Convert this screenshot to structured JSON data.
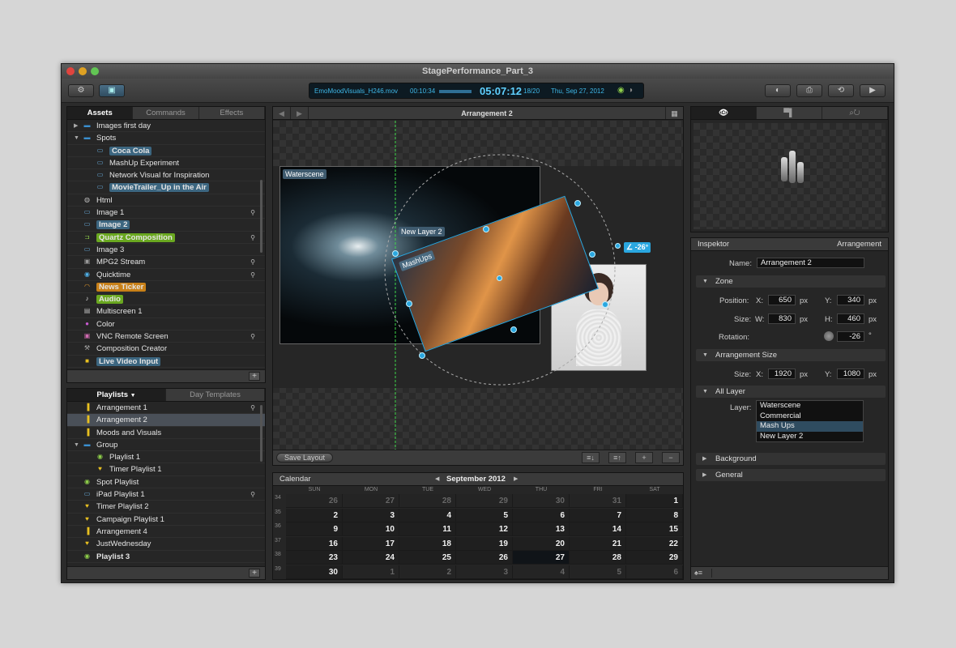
{
  "window": {
    "title": "StagePerformance_Part_3"
  },
  "toolbar": {
    "left_buttons": [
      {
        "icon": "gear-icon",
        "glyph": "⚙"
      },
      {
        "icon": "calendar-icon",
        "glyph": "▣"
      }
    ],
    "right_buttons": [
      {
        "icon": "record-icon",
        "glyph": "◐"
      },
      {
        "icon": "printer-icon",
        "glyph": "⎙"
      },
      {
        "icon": "sync-icon",
        "glyph": "⟲"
      },
      {
        "icon": "play-icon",
        "glyph": "▶"
      }
    ],
    "lcd": {
      "file": "EmoMoodVisuals_H246.mov",
      "elapsed": "00:10:34",
      "time": "05:07:12",
      "count": "18/20",
      "date": "Thu, Sep 27, 2012"
    }
  },
  "assets": {
    "tabs": [
      "Assets",
      "Commands",
      "Effects"
    ],
    "items": [
      {
        "label": "Images first day",
        "icon": "▬",
        "color": "#3a8fd0",
        "level": 0,
        "twisty": "▶"
      },
      {
        "label": "Spots",
        "icon": "▬",
        "color": "#3a8fd0",
        "level": 0,
        "twisty": "▼"
      },
      {
        "label": "Coca Cola",
        "icon": "▭",
        "color": "#6ab0e0",
        "level": 1,
        "tag": "#3c6680"
      },
      {
        "label": "MashUp Experiment",
        "icon": "▭",
        "color": "#6ab0e0",
        "level": 1
      },
      {
        "label": "Network Visual for Inspiration",
        "icon": "▭",
        "color": "#6ab0e0",
        "level": 1
      },
      {
        "label": "MovieTrailer_Up in the Air",
        "icon": "▭",
        "color": "#6ab0e0",
        "level": 1,
        "tag": "#3c6680"
      },
      {
        "label": "Html",
        "icon": "◍",
        "color": "#bbb",
        "level": 0
      },
      {
        "label": "Image 1",
        "icon": "▭",
        "color": "#6ab0e0",
        "level": 0,
        "pin": true
      },
      {
        "label": "Image 2",
        "icon": "▭",
        "color": "#6ab0e0",
        "level": 0,
        "tag": "#3c6680"
      },
      {
        "label": "Quartz Composition",
        "icon": "⊐",
        "color": "#8fd04a",
        "level": 0,
        "tag": "#6aa820",
        "pin": true
      },
      {
        "label": "Image 3",
        "icon": "▭",
        "color": "#6ab0e0",
        "level": 0
      },
      {
        "label": "MPG2 Stream",
        "icon": "▣",
        "color": "#999",
        "level": 0,
        "pin": true
      },
      {
        "label": "Quicktime",
        "icon": "◉",
        "color": "#4fb0e8",
        "level": 0,
        "pin": true
      },
      {
        "label": "News Ticker",
        "icon": "◠",
        "color": "#e89a2a",
        "level": 0,
        "tag": "#c88018"
      },
      {
        "label": "Audio",
        "icon": "♪",
        "color": "#ddd",
        "level": 0,
        "tag": "#6aa820"
      },
      {
        "label": "Multiscreen 1",
        "icon": "▤",
        "color": "#bbb",
        "level": 0
      },
      {
        "label": "Color",
        "icon": "●",
        "color": "#c85ad0",
        "level": 0
      },
      {
        "label": "VNC Remote Screen",
        "icon": "▣",
        "color": "#d06ab0",
        "level": 0,
        "pin": true
      },
      {
        "label": "Composition Creator",
        "icon": "⚒",
        "color": "#aaa",
        "level": 0
      },
      {
        "label": "Live Video Input",
        "icon": "■",
        "color": "#e8c020",
        "level": 0,
        "tag": "#3c6680"
      }
    ]
  },
  "playlists": {
    "tabs": [
      "Playlists",
      "Day Templates"
    ],
    "tab_arrow": "▼",
    "items": [
      {
        "label": "Arrangement 1",
        "icon": "▐",
        "color": "#e8c020",
        "level": 0,
        "pin": true
      },
      {
        "label": "Arrangement 2",
        "icon": "▐",
        "color": "#e8c020",
        "level": 0,
        "selected": true
      },
      {
        "label": "Moods and Visuals",
        "icon": "▐",
        "color": "#e8c020",
        "level": 0
      },
      {
        "label": "Group",
        "icon": "▬",
        "color": "#3a8fd0",
        "level": 0,
        "twisty": "▼"
      },
      {
        "label": "Playlist 1",
        "icon": "◉",
        "color": "#8fd04a",
        "level": 1
      },
      {
        "label": "Timer Playlist 1",
        "icon": "♥",
        "color": "#e8c020",
        "level": 1
      },
      {
        "label": "Spot Playlist",
        "icon": "◉",
        "color": "#8fd04a",
        "level": 0
      },
      {
        "label": "iPad Playlist 1",
        "icon": "▭",
        "color": "#6ab0e0",
        "level": 0,
        "pin": true
      },
      {
        "label": "Timer Playlist 2",
        "icon": "♥",
        "color": "#e8c020",
        "level": 0
      },
      {
        "label": "Campaign Playlist 1",
        "icon": "♥",
        "color": "#e8c020",
        "level": 0
      },
      {
        "label": "Arrangement 4",
        "icon": "▐",
        "color": "#e8c020",
        "level": 0
      },
      {
        "label": "JustWednesday",
        "icon": "♥",
        "color": "#e8c020",
        "level": 0
      },
      {
        "label": "Playlist 3",
        "icon": "◉",
        "color": "#8fd04a",
        "level": 0,
        "bold": true
      }
    ]
  },
  "stage": {
    "title": "Arrangement 2",
    "nav_back": "◀",
    "nav_forward": "▶",
    "grid_glyph": "▦",
    "layers": {
      "waterscene": "Waterscene",
      "new_layer": "New Layer 2",
      "mashups": "MashUps"
    },
    "rotation_badge": "∠ -26°",
    "save_layout": "Save Layout",
    "bottom_icons": [
      "≡↓",
      "≡↑",
      "+",
      "−"
    ]
  },
  "calendar": {
    "title": "Calendar",
    "month": "September 2012",
    "prev": "◀",
    "next": "▶",
    "weekdays": [
      "SUN",
      "MON",
      "TUE",
      "WED",
      "THU",
      "FRI",
      "SAT"
    ],
    "weeks": [
      {
        "wk": "34",
        "days": [
          [
            "26",
            0
          ],
          [
            "27",
            0
          ],
          [
            "28",
            0
          ],
          [
            "29",
            0
          ],
          [
            "30",
            0
          ],
          [
            "31",
            0
          ],
          [
            "1",
            1
          ]
        ]
      },
      {
        "wk": "35",
        "days": [
          [
            "2",
            1
          ],
          [
            "3",
            1
          ],
          [
            "4",
            1
          ],
          [
            "5",
            1
          ],
          [
            "6",
            1
          ],
          [
            "7",
            1
          ],
          [
            "8",
            1
          ]
        ]
      },
      {
        "wk": "36",
        "days": [
          [
            "9",
            1
          ],
          [
            "10",
            1
          ],
          [
            "11",
            1
          ],
          [
            "12",
            1
          ],
          [
            "13",
            1
          ],
          [
            "14",
            1
          ],
          [
            "15",
            1
          ]
        ]
      },
      {
        "wk": "37",
        "days": [
          [
            "16",
            1
          ],
          [
            "17",
            1
          ],
          [
            "18",
            1
          ],
          [
            "19",
            1
          ],
          [
            "20",
            1
          ],
          [
            "21",
            1
          ],
          [
            "22",
            1
          ]
        ]
      },
      {
        "wk": "38",
        "days": [
          [
            "23",
            1
          ],
          [
            "24",
            1
          ],
          [
            "25",
            1
          ],
          [
            "26",
            1
          ],
          [
            "27",
            1
          ],
          [
            "28",
            1
          ],
          [
            "29",
            1
          ]
        ]
      },
      {
        "wk": "39",
        "days": [
          [
            "30",
            1
          ],
          [
            "1",
            0
          ],
          [
            "2",
            0
          ],
          [
            "3",
            0
          ],
          [
            "4",
            0
          ],
          [
            "5",
            0
          ],
          [
            "6",
            0
          ]
        ]
      }
    ]
  },
  "preview": {
    "tab_icons": [
      "eye-icon",
      "screen-icon",
      "zoom-icon"
    ],
    "tab_glyphs": [
      "👁",
      "▀▌",
      "⌕↻"
    ]
  },
  "inspector": {
    "title": "Inspektor",
    "context": "Arrangement",
    "name_label": "Name:",
    "name_value": "Arrangement 2",
    "zone_label": "Zone",
    "position_label": "Position:",
    "size_label": "Size:",
    "rotation_label": "Rotation:",
    "x_label": "X:",
    "y_label": "Y:",
    "w_label": "W:",
    "h_label": "H:",
    "px": "px",
    "deg": "°",
    "pos_x": "650",
    "pos_y": "340",
    "size_w": "830",
    "size_h": "460",
    "rotation": "-26",
    "arr_size_label": "Arrangement Size",
    "arr_w": "1920",
    "arr_h": "1080",
    "all_layer_label": "All Layer",
    "layer_label": "Layer:",
    "layers": [
      "Waterscene",
      "Commercial",
      "Mash Ups",
      "New Layer 2"
    ],
    "selected_layer": 2,
    "background_label": "Background",
    "general_label": "General",
    "collapse_glyph": "▼",
    "expand_glyph": "▶"
  }
}
